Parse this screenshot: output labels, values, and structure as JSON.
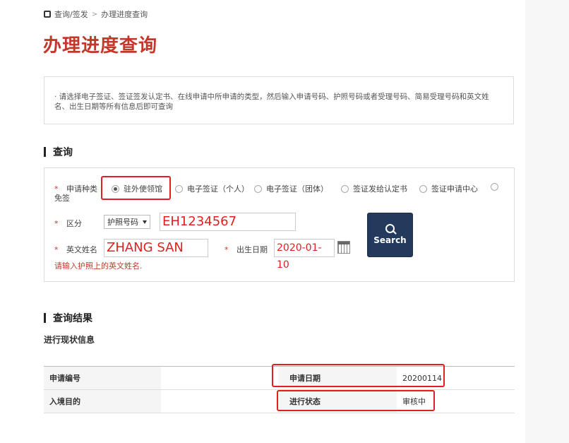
{
  "breadcrumb": {
    "items": [
      "查询/签发",
      "办理进度查询"
    ],
    "sep": ">"
  },
  "page_title": "办理进度查询",
  "notice": "· 请选择电子签证、签证签发认定书、在线申请中所申请的类型，然后输入申请号码、护照号码或者受理号码、简易受理号码和英文姓名、出生日期等所有信息后即可查询",
  "query": {
    "section_title": "查询",
    "required_mark": "*",
    "type_label": "申请种类",
    "types": [
      "驻外使领馆",
      "电子签证（个人）",
      "电子签证（团体）",
      "签证发给认定书",
      "签证申请中心",
      "免签"
    ],
    "selected_type": "驻外使领馆",
    "division_label": "区分",
    "division_value": "护照号码",
    "passport_value": "EH1234567",
    "name_label": "英文姓名",
    "name_value": "ZHANG SAN",
    "dob_label": "出生日期",
    "dob_value": "2020-01-10",
    "search_label": "Search",
    "hint": "请输入护照上的英文姓名."
  },
  "results": {
    "section_title": "查询结果",
    "sub_title": "进行现状信息",
    "rows": [
      {
        "h1": "申请编号",
        "v1": "",
        "h2": "申请日期",
        "v2": "20200114"
      },
      {
        "h1": "入境目的",
        "v1": "",
        "h2": "进行状态",
        "v2": "审核中"
      }
    ]
  }
}
